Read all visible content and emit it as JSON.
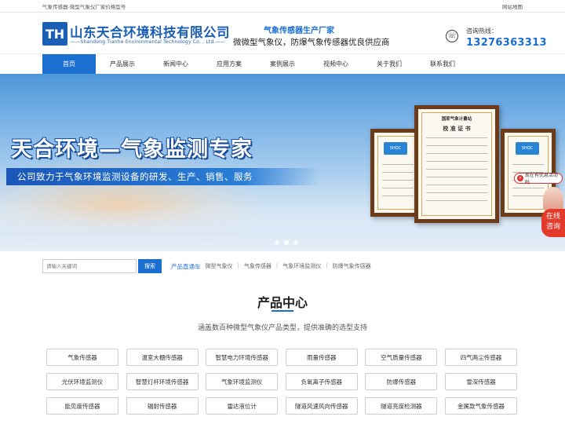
{
  "topbar": {
    "left_text": "气象传感器-微型气象仪厂家价格型号",
    "right_text": "网站地图"
  },
  "header": {
    "logo_mark": "TH",
    "brand_cn": "山东天合环境科技有限公司",
    "brand_en": "——Shandong Tianhe Environmental Technology Co. , Ltd.——",
    "slogan1": "气象传感器生产厂家",
    "slogan2": "微微型气象仪，防爆气象传感器优良供应商",
    "hotline_label": "咨询热线：",
    "hotline_number": "13276363313"
  },
  "nav": {
    "items": [
      "首页",
      "产品展示",
      "新闻中心",
      "应用方案",
      "案例展示",
      "视频中心",
      "关于我们",
      "联系我们"
    ],
    "active_index": 0
  },
  "banner": {
    "title": "天合环境—气象监测专家",
    "subtitle": "公司致力于气象环境监测设备的研发、生产、销售、服务",
    "cert_center_title": "国家气象计量站",
    "cert_center_title2": "校 准 证 书",
    "cert_badge": "SHQC",
    "slide_count": 3,
    "active_slide": 1
  },
  "float": {
    "tip_text": "现在有优惠活动吗",
    "tip_close": "×",
    "chat_line1": "在线",
    "chat_line2": "咨询"
  },
  "search": {
    "placeholder": "请输入关键词",
    "button_label": "搜索",
    "hot_label": "产品直通车",
    "hot_items": [
      "微型气象仪",
      "气象传感器",
      "气象环境监测仪",
      "防爆气象传感器"
    ]
  },
  "product_center": {
    "title": "产品中心",
    "description": "涵盖数百种微型气象仪产品类型，提供准确的选型支持",
    "items": [
      "气象传感器",
      "温室大棚传感器",
      "智慧电力环境传感器",
      "雨量传感器",
      "空气质量传感器",
      "四气两尘传感器",
      "光伏环境监测仪",
      "智慧灯杆环境传感器",
      "气象环境监测仪",
      "负氧离子传感器",
      "防爆传感器",
      "雪深传感器",
      "能见度传感器",
      "辐射传感器",
      "雷达液位计",
      "隧道风速风向传感器",
      "隧道亮度检测器",
      "金属款气象传感器"
    ]
  },
  "colors": {
    "primary": "#1a6fd1",
    "brand": "#1a5fb4",
    "chat": "#e33a2c"
  }
}
